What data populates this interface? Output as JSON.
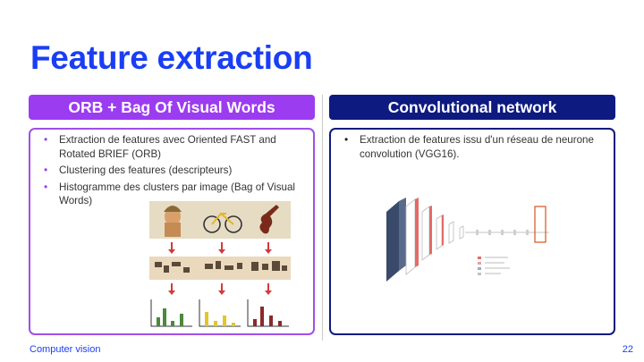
{
  "slide": {
    "title": "Feature extraction",
    "footer_left": "Computer vision",
    "page_number": "22"
  },
  "left": {
    "header": "ORB + Bag Of Visual Words",
    "bullets": [
      "Extraction de features avec Oriented FAST and Rotated BRIEF (ORB)",
      "Clustering des features (descripteurs)",
      "Histogramme des clusters par image (Bag of Visual Words)"
    ]
  },
  "right": {
    "header": "Convolutional network",
    "bullets": [
      "Extraction de features issu d'un réseau de neurone convolution (VGG16)."
    ]
  },
  "colors": {
    "title_blue": "#1a3ef5",
    "left_accent": "#9b3cf0",
    "right_accent": "#0d1a80"
  }
}
